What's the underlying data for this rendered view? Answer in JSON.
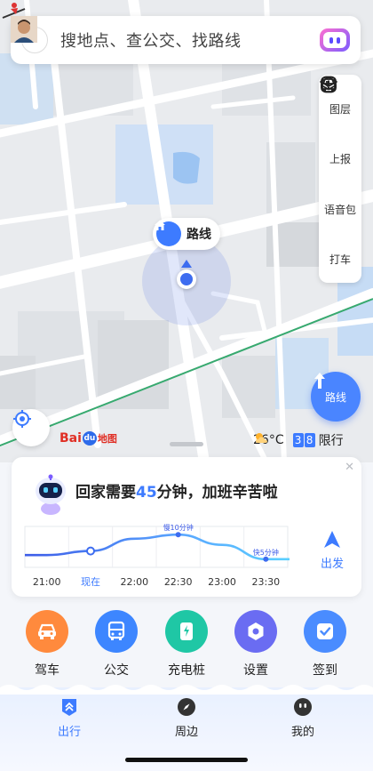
{
  "search": {
    "placeholder": "搜地点、查公交、找路线"
  },
  "map_tools": [
    {
      "label": "图层",
      "icon": "layers-icon"
    },
    {
      "label": "上报",
      "icon": "report-icon"
    },
    {
      "label": "语音包",
      "icon": "voice-pack-icon"
    },
    {
      "label": "打车",
      "icon": "taxi-icon"
    }
  ],
  "route_bubble": {
    "label": "路线",
    "icon": "home-icon"
  },
  "nav_button": {
    "label": "路线",
    "icon": "turn-arrow-icon"
  },
  "map_brand": {
    "bai": "Bai",
    "du": "du",
    "map": "地图"
  },
  "weather": {
    "temperature": "26°C",
    "plate_digits": [
      "3",
      "8"
    ],
    "restriction_label": "限行",
    "icon": "partly-cloudy-icon"
  },
  "commute_card": {
    "message_prefix": "回家需要",
    "minutes": "45",
    "message_suffix": "分钟，加班辛苦啦",
    "depart_label": "出发",
    "chart_annotations": {
      "peak": "慢10分钟",
      "end": "快5分钟"
    }
  },
  "chart_data": {
    "type": "line",
    "categories": [
      "21:00",
      "现在",
      "22:00",
      "22:30",
      "23:00",
      "23:30"
    ],
    "series": [
      {
        "values": [
          42,
          44,
          50,
          52,
          47,
          40
        ]
      }
    ],
    "annotations": [
      {
        "x": "22:30",
        "text": "慢10分钟"
      },
      {
        "x": "23:30",
        "text": "快5分钟"
      }
    ],
    "highlight_category": "现在",
    "grid": true
  },
  "shortcuts": [
    {
      "label": "驾车",
      "icon": "car-icon",
      "color": "#ff8a3d"
    },
    {
      "label": "公交",
      "icon": "bus-icon",
      "color": "#3d86ff"
    },
    {
      "label": "充电桩",
      "icon": "charging-pile-icon",
      "color": "#1fc7a5"
    },
    {
      "label": "设置",
      "icon": "settings-icon",
      "color": "#6a6cf2"
    },
    {
      "label": "签到",
      "icon": "checkin-icon",
      "color": "#4a8cff"
    }
  ],
  "bottom_tabs": [
    {
      "label": "出行",
      "icon": "travel-icon",
      "active": true
    },
    {
      "label": "周边",
      "icon": "compass-icon",
      "active": false
    },
    {
      "label": "我的",
      "icon": "profile-icon",
      "active": false
    }
  ]
}
